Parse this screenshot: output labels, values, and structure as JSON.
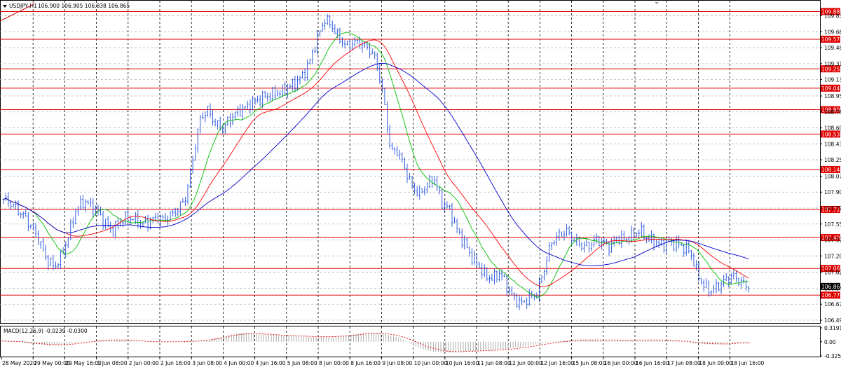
{
  "chart_data": {
    "type": "line",
    "symbol": "USDJPY,H1",
    "ohlc_header": "106.900 106.905 106.838 106.865",
    "current_price": "106.865",
    "y_ticks": [
      "109.835",
      "109.660",
      "109.485",
      "109.310",
      "109.135",
      "108.955",
      "108.780",
      "108.605",
      "108.430",
      "108.255",
      "108.075",
      "107.900",
      "107.725",
      "107.550",
      "107.375",
      "107.200",
      "107.020",
      "106.845",
      "106.670",
      "106.495"
    ],
    "ylim": [
      106.495,
      109.97
    ],
    "x_ticks": [
      "28 May 2020",
      "29 May 00:00",
      "29 May 16:00",
      "1 Jun 08:00",
      "2 Jun 00:00",
      "2 Jun 16:00",
      "3 Jun 08:00",
      "4 Jun 00:00",
      "4 Jun 16:00",
      "5 Jun 08:00",
      "8 Jun 00:00",
      "8 Jun 16:00",
      "9 Jun 08:00",
      "10 Jun 00:00",
      "10 Jun 16:00",
      "11 Jun 08:00",
      "12 Jun 00:00",
      "12 Jun 16:00",
      "15 Jun 08:00",
      "16 Jun 00:00",
      "16 Jun 16:00",
      "17 Jun 08:00",
      "18 Jun 00:00",
      "18 Jun 16:00"
    ],
    "levels": [
      {
        "label": "109.882",
        "value": 109.882
      },
      {
        "label": "109.578",
        "value": 109.578
      },
      {
        "label": "109.253",
        "value": 109.253
      },
      {
        "label": "109.041",
        "value": 109.041
      },
      {
        "label": "108.805",
        "value": 108.805
      },
      {
        "label": "108.537",
        "value": 108.537
      },
      {
        "label": "108.148",
        "value": 108.148
      },
      {
        "label": "107.710",
        "value": 107.71
      },
      {
        "label": "107.402",
        "value": 107.402
      },
      {
        "label": "107.062",
        "value": 107.062
      },
      {
        "label": "106.770",
        "value": 106.77
      }
    ],
    "price_series": [
      107.82,
      107.78,
      107.7,
      107.62,
      107.5,
      107.35,
      107.15,
      107.08,
      107.2,
      107.45,
      107.72,
      107.8,
      107.75,
      107.68,
      107.55,
      107.48,
      107.58,
      107.62,
      107.6,
      107.55,
      107.58,
      107.62,
      107.6,
      107.65,
      107.72,
      107.85,
      108.3,
      108.72,
      108.8,
      108.65,
      108.6,
      108.7,
      108.78,
      108.82,
      108.88,
      108.92,
      108.95,
      108.98,
      109.0,
      109.05,
      109.1,
      109.18,
      109.35,
      109.6,
      109.8,
      109.72,
      109.58,
      109.5,
      109.55,
      109.52,
      109.48,
      109.35,
      108.95,
      108.35,
      108.35,
      108.15,
      107.95,
      107.88,
      107.98,
      108.05,
      107.78,
      107.72,
      107.5,
      107.35,
      107.2,
      107.1,
      106.98,
      106.95,
      107.02,
      106.85,
      106.72,
      106.68,
      106.75,
      106.78,
      107.05,
      107.35,
      107.42,
      107.48,
      107.38,
      107.32,
      107.3,
      107.38,
      107.35,
      107.3,
      107.4,
      107.38,
      107.42,
      107.48,
      107.4,
      107.36,
      107.32,
      107.35,
      107.34,
      107.3,
      107.25,
      107.0,
      106.85,
      106.82,
      106.88,
      106.95,
      106.98,
      106.9,
      106.87
    ],
    "series": [
      {
        "name": "MA fast",
        "color": "#00c000",
        "period": 5
      },
      {
        "name": "MA mid",
        "color": "#ff0000",
        "period": 10
      },
      {
        "name": "MA slow",
        "color": "#0000cc",
        "period": 20
      }
    ],
    "macd": {
      "label": "MACD(12,26,9) -0.0239 -0.0300",
      "y_ticks": [
        "0.3191",
        "0.00",
        "-0.3255"
      ],
      "ylim": [
        -0.3255,
        0.3191
      ],
      "histogram": [
        0.02,
        0.01,
        -0.02,
        -0.05,
        -0.07,
        -0.08,
        -0.06,
        -0.03,
        0.0,
        0.02,
        0.04,
        0.05,
        0.04,
        0.02,
        0.0,
        -0.01,
        0.0,
        0.0,
        0.01,
        0.02,
        0.05,
        0.1,
        0.16,
        0.2,
        0.2,
        0.18,
        0.16,
        0.14,
        0.13,
        0.12,
        0.11,
        0.11,
        0.12,
        0.14,
        0.17,
        0.2,
        0.21,
        0.18,
        0.12,
        0.02,
        -0.12,
        -0.2,
        -0.24,
        -0.25,
        -0.24,
        -0.22,
        -0.21,
        -0.2,
        -0.18,
        -0.15,
        -0.12,
        -0.08,
        -0.04,
        0.0,
        0.03,
        0.04,
        0.05,
        0.05,
        0.04,
        0.03,
        0.03,
        0.04,
        0.04,
        0.04,
        0.03,
        0.02,
        0.0,
        -0.03,
        -0.06,
        -0.06,
        -0.04,
        -0.02,
        -0.02
      ],
      "signal": [
        0.02,
        0.01,
        0.0,
        -0.03,
        -0.05,
        -0.07,
        -0.07,
        -0.05,
        -0.02,
        0.01,
        0.03,
        0.04,
        0.04,
        0.03,
        0.01,
        0.0,
        0.0,
        0.0,
        0.01,
        0.02,
        0.04,
        0.08,
        0.13,
        0.17,
        0.19,
        0.18,
        0.17,
        0.15,
        0.14,
        0.13,
        0.12,
        0.12,
        0.12,
        0.13,
        0.15,
        0.18,
        0.2,
        0.19,
        0.15,
        0.08,
        -0.02,
        -0.12,
        -0.18,
        -0.22,
        -0.23,
        -0.22,
        -0.21,
        -0.2,
        -0.19,
        -0.17,
        -0.14,
        -0.11,
        -0.07,
        -0.03,
        0.0,
        0.02,
        0.04,
        0.04,
        0.04,
        0.04,
        0.03,
        0.03,
        0.04,
        0.04,
        0.03,
        0.02,
        0.01,
        -0.02,
        -0.04,
        -0.05,
        -0.05,
        -0.03,
        -0.03
      ]
    }
  }
}
